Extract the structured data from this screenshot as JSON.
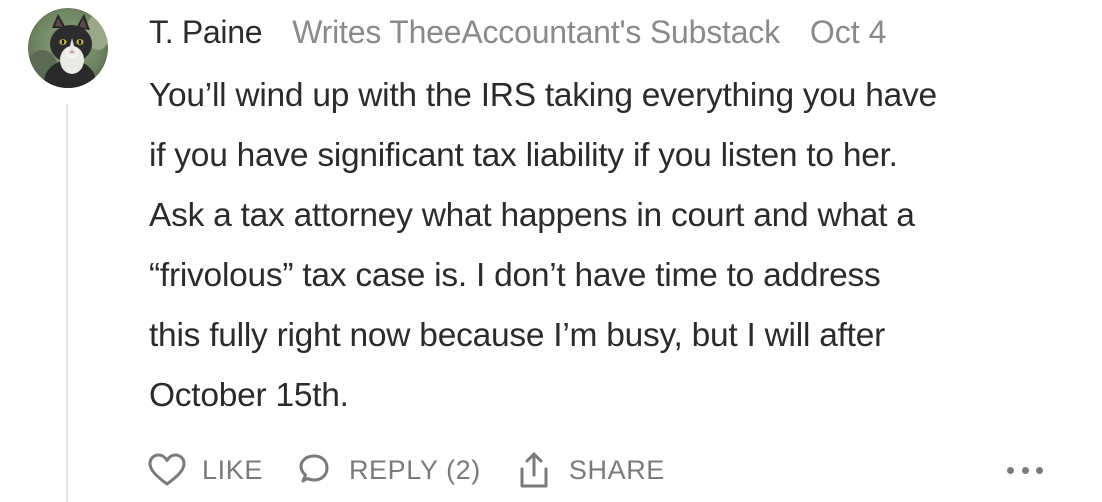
{
  "comment": {
    "author": "T. Paine",
    "byline": "Writes TheeAccountant's Substack",
    "date": "Oct 4",
    "avatar_icon": "cat-avatar",
    "body_lines": [
      "You’ll wind up with the IRS taking everything you have",
      "if you have significant tax liability if you listen to her.",
      "Ask a tax attorney what happens in court and what a",
      "“frivolous” tax case is. I don’t have time to address",
      "this fully right now because I’m busy, but I will after",
      "October 15th."
    ],
    "actions": {
      "like_label": "LIKE",
      "like_icon": "heart-icon",
      "reply_label": "REPLY (2)",
      "reply_icon": "speech-bubble-icon",
      "share_label": "SHARE",
      "share_icon": "share-icon",
      "more_icon": "ellipsis-icon"
    }
  },
  "colors": {
    "text": "#2b2b2b",
    "muted": "#8a8a8a",
    "action": "#7a7a7a",
    "thread_line": "#e6e6e6"
  }
}
